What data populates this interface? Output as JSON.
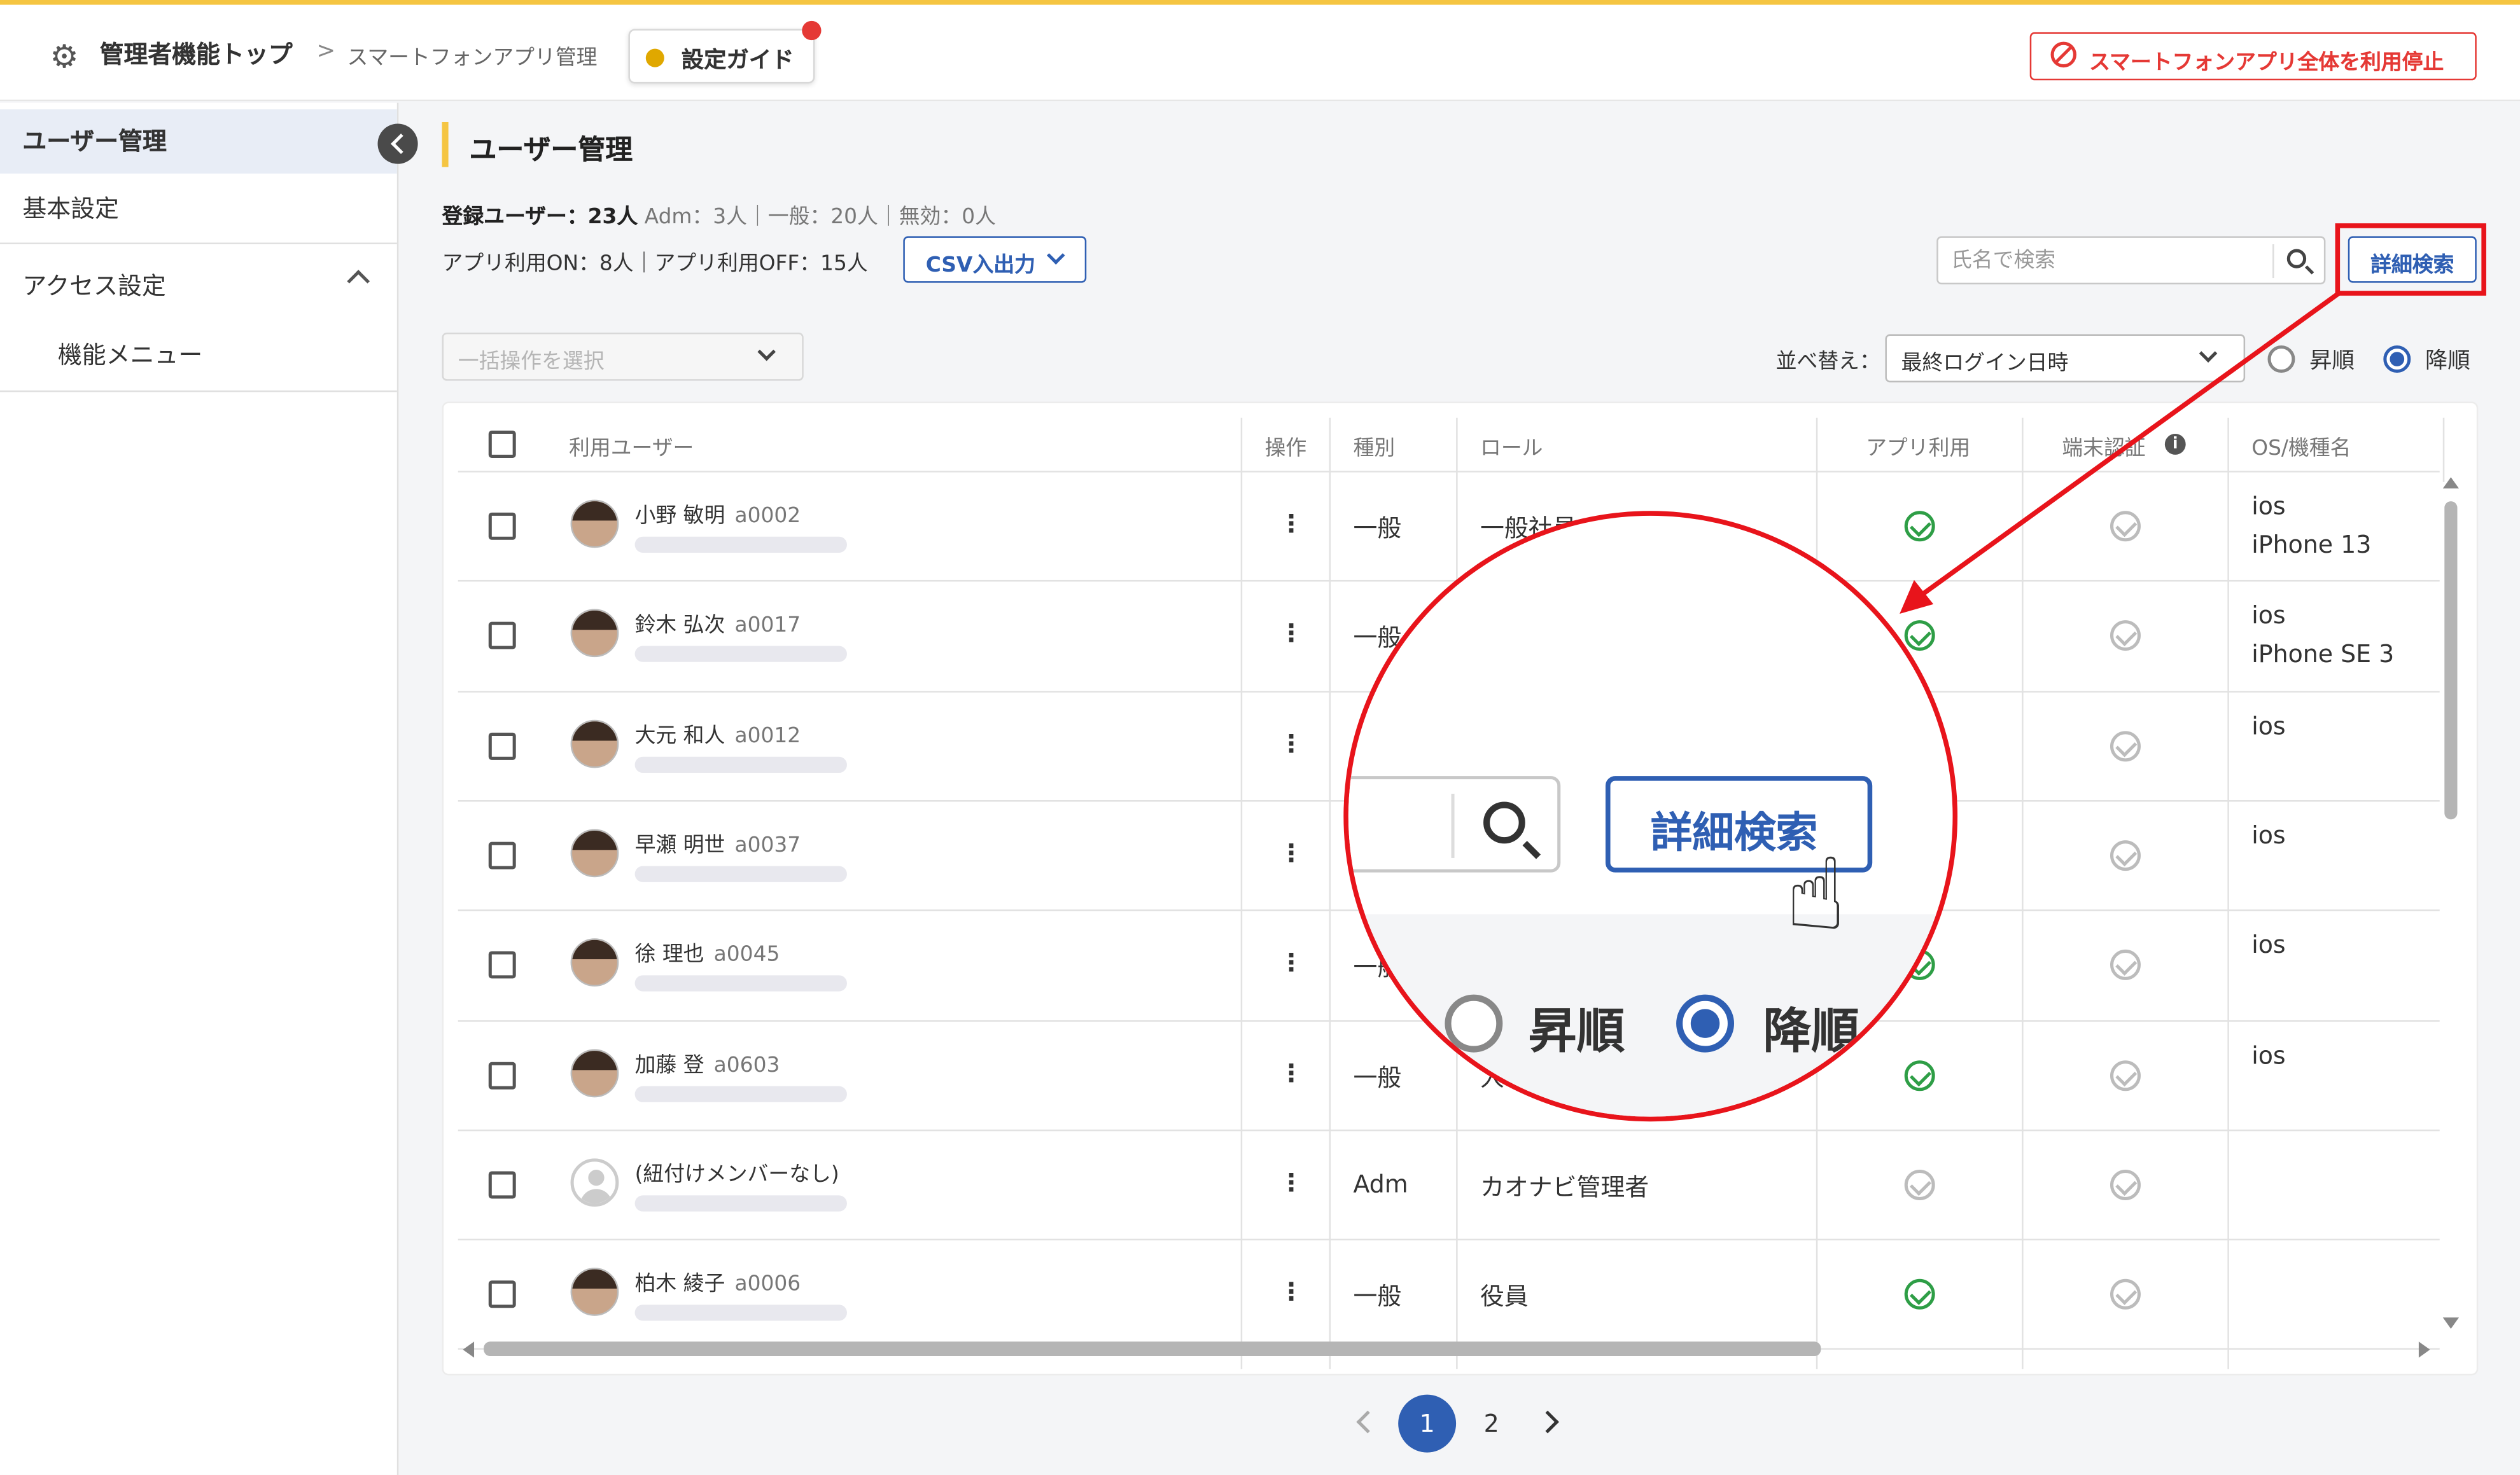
{
  "header": {
    "breadcrumb_top": "管理者機能トップ",
    "breadcrumb_current": "スマートフォンアプリ管理",
    "guide_label": "設定ガイド",
    "stop_all_label": "スマートフォンアプリ全体を利用停止"
  },
  "sidebar": {
    "items": [
      {
        "label": "ユーザー管理"
      },
      {
        "label": "基本設定"
      },
      {
        "label": "アクセス設定"
      },
      {
        "label": "機能メニュー"
      }
    ]
  },
  "page": {
    "title": "ユーザー管理",
    "stats": {
      "registered": "登録ユーザー：23人",
      "breakdown": "Adm：3人｜一般：20人｜無効：0人",
      "app_usage": "アプリ利用ON：8人｜アプリ利用OFF：15人"
    },
    "csv_label": "CSV入出力",
    "search_placeholder": "氏名で検索",
    "advanced_search_label": "詳細検索",
    "bulk_placeholder": "一括操作を選択",
    "sort_label": "並べ替え：",
    "sort_value": "最終ログイン日時",
    "order_asc": "昇順",
    "order_desc": "降順"
  },
  "table": {
    "headers": [
      "利用ユーザー",
      "操作",
      "種別",
      "ロール",
      "アプリ利用",
      "端末認証",
      "OS/機種名"
    ],
    "rows": [
      {
        "name": "小野 敏明",
        "code": "a0002",
        "menu": "⋮",
        "type": "一般",
        "role": "一般社員",
        "app": true,
        "device": false,
        "os": "ios",
        "model": "iPhone 13"
      },
      {
        "name": "鈴木 弘次",
        "code": "a0017",
        "menu": "⋮",
        "type": "一般",
        "role": "",
        "app": true,
        "device": false,
        "os": "ios",
        "model": "iPhone SE 3"
      },
      {
        "name": "大元 和人",
        "code": "a0012",
        "menu": "⋮",
        "type": "",
        "role": "",
        "app": false,
        "device": false,
        "os": "ios",
        "model": ""
      },
      {
        "name": "早瀬 明世",
        "code": "a0037",
        "menu": "⋮",
        "type": "",
        "role": "",
        "app": false,
        "device": false,
        "os": "ios",
        "model": ""
      },
      {
        "name": "徐 理也",
        "code": "a0045",
        "menu": "⋮",
        "type": "一般",
        "role": "",
        "app": true,
        "device": false,
        "os": "ios",
        "model": ""
      },
      {
        "name": "加藤 登",
        "code": "a0603",
        "menu": "⋮",
        "type": "一般",
        "role": "人",
        "app": true,
        "device": false,
        "os": "ios",
        "model": ""
      },
      {
        "name": "(紐付けメンバーなし)",
        "code": "",
        "menu": "⋮",
        "type": "Adm",
        "role": "カオナビ管理者",
        "app": false,
        "device": false,
        "os": "",
        "model": ""
      },
      {
        "name": "柏木 綾子",
        "code": "a0006",
        "menu": "⋮",
        "type": "一般",
        "role": "役員",
        "app": true,
        "device": false,
        "os": "",
        "model": ""
      }
    ]
  },
  "pagination": {
    "pages": [
      "1",
      "2"
    ],
    "current": "1"
  },
  "zoom": {
    "advanced_search_label": "詳細検索",
    "order_asc": "昇順",
    "order_desc": "降順"
  },
  "colors": {
    "accent": "#2f5fb3",
    "highlight": "#e8141b",
    "header_stripe": "#f5c542",
    "check_ok": "#2e9e46"
  },
  "icons": [
    "gear-icon",
    "bulb-icon",
    "prohibit-icon",
    "search-icon",
    "chevron-down-icon",
    "chevron-up-icon",
    "collapse-left-icon",
    "info-icon",
    "check-circle-icon",
    "kebab-menu-icon",
    "pointer-hand-icon"
  ]
}
